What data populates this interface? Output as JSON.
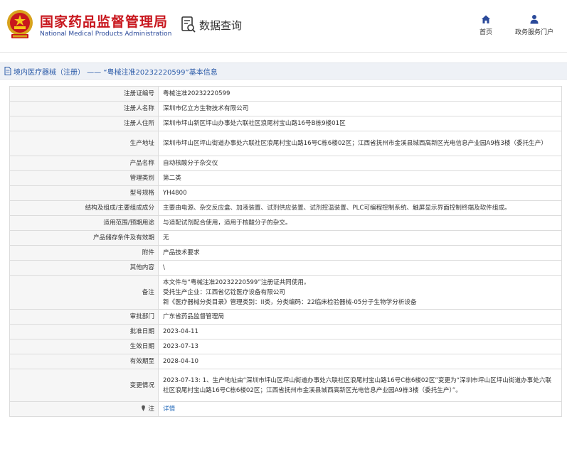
{
  "header": {
    "org_name_cn": "国家药品监督管理局",
    "org_name_en": "National Medical Products Administration",
    "data_query_label": "数据查询",
    "nav": [
      {
        "label": "首页",
        "icon": "home-icon"
      },
      {
        "label": "政务服务门户",
        "icon": "person-icon"
      }
    ]
  },
  "breadcrumb": {
    "text": "境内医疗器械（注册） —— “粤械注准20232220599”基本信息"
  },
  "details": {
    "rows": [
      {
        "label": "注册证编号",
        "value": "粤械注准20232220599"
      },
      {
        "label": "注册人名称",
        "value": "深圳市亿立方生物技术有限公司"
      },
      {
        "label": "注册人住所",
        "value": "深圳市坪山新区坪山办事处六联社区浪尾村宝山路16号B栋9楼01区"
      },
      {
        "label": "生产地址",
        "value": "深圳市坪山区坪山街道办事处六联社区浪尾村宝山路16号C栋6楼02区；江西省抚州市金溪县城西高新区光电信息产业园A9栋3楼（委托生产）"
      },
      {
        "label": "产品名称",
        "value": "自动核酸分子杂交仪"
      },
      {
        "label": "管理类别",
        "value": "第二类"
      },
      {
        "label": "型号规格",
        "value": "YH4800"
      },
      {
        "label": "结构及组成/主要组成成分",
        "value": "主要由电源、杂交反应盒、加液装置、试剂供应装置、试剂控温装置、PLC可编程控制系统、触屏显示界面控制终端及软件组成。"
      },
      {
        "label": "适用范围/预期用途",
        "value": "与适配试剂配合使用，适用于核酸分子的杂交。"
      },
      {
        "label": "产品储存条件及有效期",
        "value": "无"
      },
      {
        "label": "附件",
        "value": "产品技术要求"
      },
      {
        "label": "其他内容",
        "value": "\\"
      },
      {
        "label": "备注",
        "lines": [
          "本文件与“粤械注准20232220599”注册证共同使用。",
          "受托生产企业：江西省亿铨医疗设备有限公司",
          "新《医疗器械分类目录》管理类别：II类，分类编码：22临床检验器械-05分子生物学分析设备"
        ]
      },
      {
        "label": "审批部门",
        "value": "广东省药品监督管理局"
      },
      {
        "label": "批准日期",
        "value": "2023-04-11"
      },
      {
        "label": "生效日期",
        "value": "2023-07-13"
      },
      {
        "label": "有效期至",
        "value": "2028-04-10"
      },
      {
        "label": "变更情况",
        "value": "2023-07-13: 1、生产地址由“深圳市坪山区坪山街道办事处六联社区浪尾村宝山路16号C栋6楼02区”变更为“深圳市坪山区坪山街道办事处六联社区浪尾村宝山路16号C栋6楼02区；江西省抚州市金溪县城西高新区光电信息产业园A9栋3楼（委托生产）”。"
      },
      {
        "label": "注",
        "value": "详情"
      }
    ]
  },
  "colors": {
    "brand_red": "#c8161d",
    "brand_blue": "#2b4a9a",
    "link_blue": "#2a6ebb",
    "label_bg": "#f6f6f6"
  }
}
